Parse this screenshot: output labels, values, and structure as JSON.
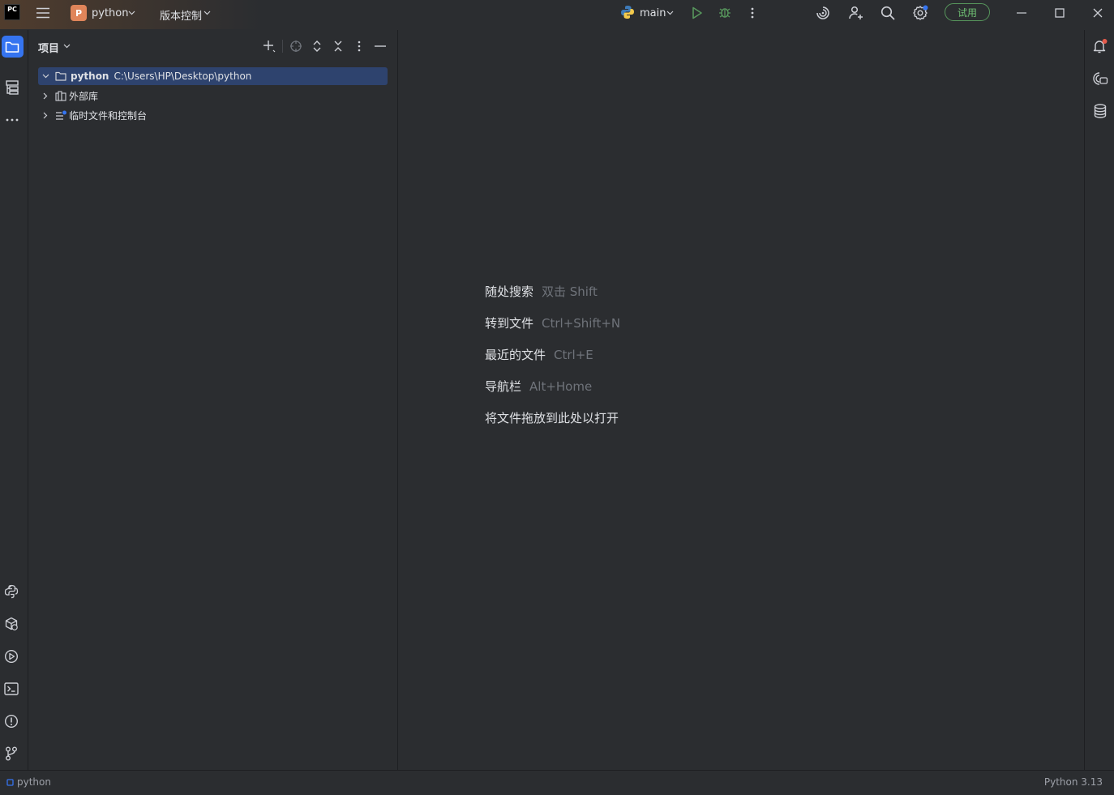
{
  "app": {
    "logo": "PC"
  },
  "titlebar": {
    "project_badge": "P",
    "project_name": "python",
    "vcs_menu": "版本控制",
    "run_config": "main",
    "trial_label": "试用"
  },
  "project_panel": {
    "title": "项目",
    "tree": [
      {
        "label": "python",
        "path": "C:\\Users\\HP\\Desktop\\python",
        "expanded": true,
        "selected": true
      },
      {
        "label": "外部库",
        "expanded": false
      },
      {
        "label": "临时文件和控制台",
        "expanded": false
      }
    ]
  },
  "editor": {
    "hints": [
      {
        "action": "随处搜索",
        "shortcut": "双击 Shift"
      },
      {
        "action": "转到文件",
        "shortcut": "Ctrl+Shift+N"
      },
      {
        "action": "最近的文件",
        "shortcut": "Ctrl+E"
      },
      {
        "action": "导航栏",
        "shortcut": "Alt+Home"
      },
      {
        "action": "将文件拖放到此处以打开",
        "shortcut": ""
      }
    ]
  },
  "statusbar": {
    "project": "python",
    "interpreter": "Python 3.13"
  },
  "colors": {
    "background": "#2b2d30",
    "accent": "#3574f0",
    "selection": "#2e436e",
    "run_green": "#57965c",
    "trial_green": "#6fbf73",
    "project_badge": "#e0855a",
    "notification_dot": "#e55b4c"
  }
}
